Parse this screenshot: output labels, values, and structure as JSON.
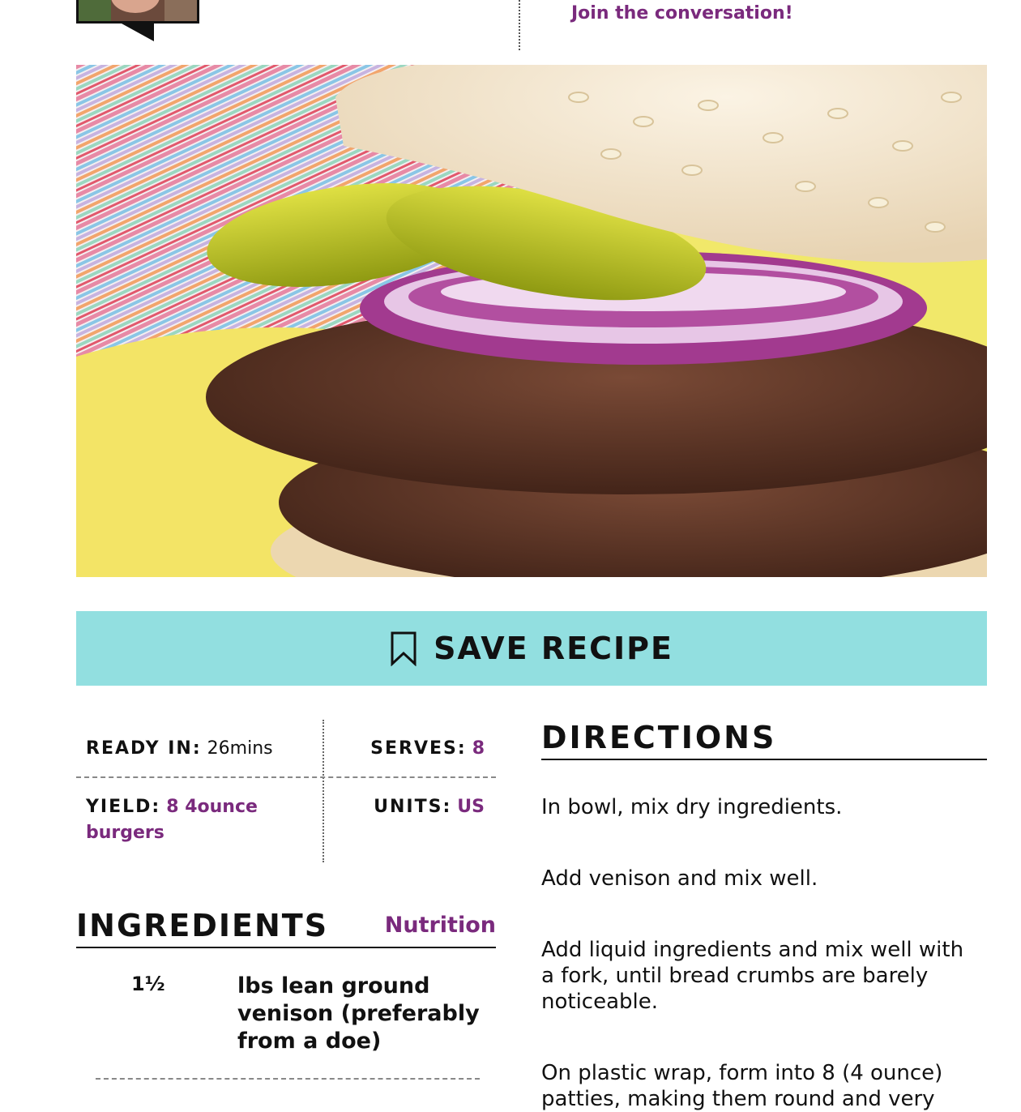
{
  "header": {
    "join_link": "Join the conversation!"
  },
  "hero": {
    "alt": "Venison burger with pickles and red onion on sesame bun"
  },
  "save": {
    "label": "SAVE RECIPE"
  },
  "meta": {
    "ready_label": "READY IN:",
    "ready_value": "26mins",
    "serves_label": "SERVES:",
    "serves_value": "8",
    "yield_label": "YIELD:",
    "yield_value": "8 4ounce burgers",
    "units_label": "UNITS:",
    "units_value": "US"
  },
  "ingredients": {
    "title": "INGREDIENTS",
    "nutrition_link": "Nutrition",
    "items": [
      {
        "qty": "1½",
        "name": "lbs lean ground venison (preferably from a doe)"
      }
    ]
  },
  "directions": {
    "title": "DIRECTIONS",
    "steps": [
      "In bowl, mix dry ingredients.",
      "Add venison and mix well.",
      "Add liquid ingredients and mix well with a fork, until bread crumbs are barely noticeable.",
      "On plastic wrap, form into 8 (4 ounce) patties, making them round and very"
    ]
  },
  "colors": {
    "accent_link": "#7a2a7d",
    "save_bar": "#92dfe0"
  }
}
